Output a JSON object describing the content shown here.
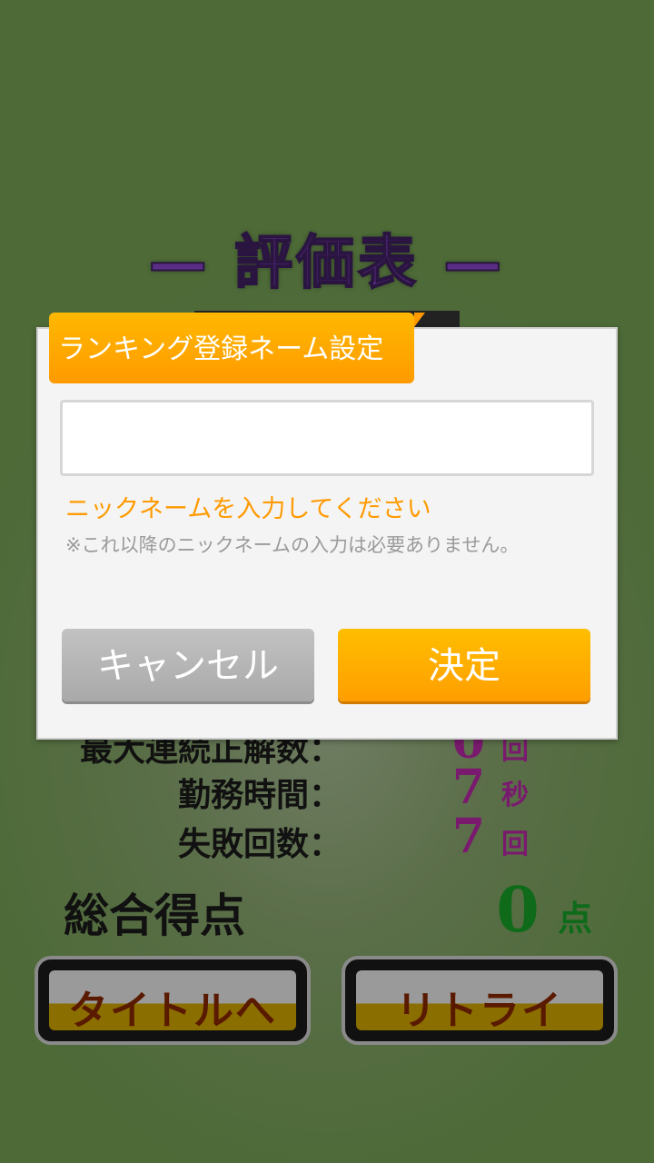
{
  "screen": {
    "title": "— 評価表 —"
  },
  "stats": [
    {
      "label": "最大連続正解数：",
      "value": "0",
      "unit": "回"
    },
    {
      "label": "勤務時間：",
      "value": "7",
      "unit": "秒"
    },
    {
      "label": "失敗回数：",
      "value": "7",
      "unit": "回"
    }
  ],
  "score": {
    "label": "総合得点",
    "value": "0",
    "unit": "点"
  },
  "buttons": {
    "to_title": "タイトルへ",
    "retry": "リトライ"
  },
  "dialog": {
    "title": "ランキング登録ネーム設定",
    "input_value": "",
    "hint": "ニックネームを入力してください",
    "note": "※これ以降のニックネームの入力は必要ありません。",
    "cancel_label": "キャンセル",
    "ok_label": "決定"
  },
  "colors": {
    "accent": "#ff9a00",
    "title_purple": "#5a2e86",
    "stat_value": "#7a1a6e",
    "score_green": "#0f6a1a"
  }
}
